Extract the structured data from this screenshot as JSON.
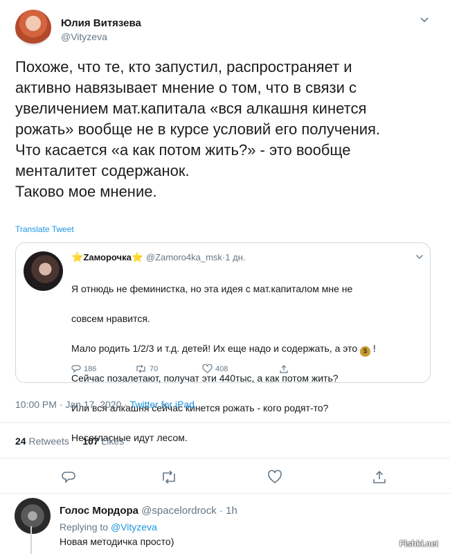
{
  "tweet": {
    "author_name": "Юлия Витязева",
    "author_handle": "@Vityzeva",
    "text": "Похоже, что те, кто запустил, распространяет и\nактивно навязывает мнение о том, что в связи с\nувеличением мат.капитала «вся алкашня кинется\nрожать» вообще не в курсе условий его получения.\nЧто касается «а как потом жить?» - это вообще\nменталитет содержанок.\nТаково мое мнение.",
    "translate_label": "Translate Tweet",
    "time": "10:00 PM",
    "date": "Jan 17, 2020",
    "separator": "·",
    "source": "Twitter for iPad",
    "retweets_count": "24",
    "retweets_label": "Retweets",
    "likes_count": "107",
    "likes_label": "Likes",
    "actions": [
      "reply-icon",
      "retweet-icon",
      "like-icon",
      "share-icon"
    ]
  },
  "quote": {
    "author_name": "Zаморочка",
    "star_left": "⭐",
    "star_right": "⭐",
    "author_handle": "@Zamoro4ka_msk",
    "time_ago": "1 дн.",
    "text_lines": [
      "Я отнюдь не феминистка, но эта идея с мат.капиталом мне не",
      "совсем нравится.",
      "Мало родить 1/2/3 и т.д. детей! Их еще надо и содержать, а это",
      "Сейчас позалетают, получат эти 440тыс, а как потом жить?",
      "Или вся алкашня сейчас кинется рожать -  кого родят-то?",
      "Несогласные идут лесом."
    ],
    "money_emoji": "$",
    "exclamation": "!",
    "replies": "186",
    "retweets": "70",
    "likes": "408"
  },
  "reply": {
    "author_name": "Голос Мордора",
    "author_handle": "@spacelordrock",
    "time_ago": "1h",
    "replying_prefix": "Replying to",
    "replying_to": "@Vityzeva",
    "text": "Новая методичка просто)"
  },
  "watermark": "Fishki.net",
  "colors": {
    "link": "#1b95e0",
    "muted": "#657786",
    "text": "#14171a",
    "border": "#cfd9de"
  }
}
